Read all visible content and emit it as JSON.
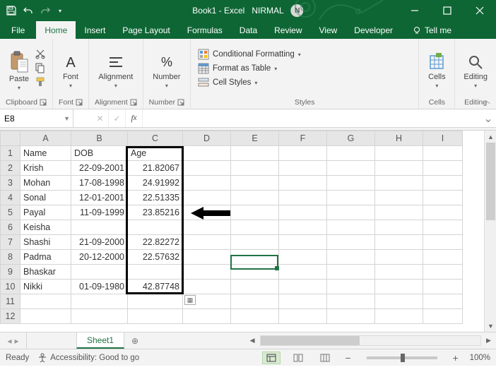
{
  "title": {
    "doc": "Book1",
    "app": "Excel",
    "user": "NIRMAL",
    "initial": "N"
  },
  "tabs": {
    "file": "File",
    "home": "Home",
    "insert": "Insert",
    "pageLayout": "Page Layout",
    "formulas": "Formulas",
    "data": "Data",
    "review": "Review",
    "view": "View",
    "developer": "Developer",
    "tellme": "Tell me"
  },
  "ribbon": {
    "clipboard": {
      "paste": "Paste",
      "label": "Clipboard"
    },
    "font": {
      "btn": "Font",
      "label": "Font"
    },
    "alignment": {
      "btn": "Alignment",
      "label": "Alignment"
    },
    "number": {
      "btn": "Number",
      "label": "Number"
    },
    "styles": {
      "cond": "Conditional Formatting",
      "table": "Format as Table",
      "cell": "Cell Styles",
      "label": "Styles"
    },
    "cells": {
      "btn": "Cells",
      "label": "Cells"
    },
    "editing": {
      "btn": "Editing",
      "label": "Editing"
    }
  },
  "namebox": "E8",
  "grid": {
    "cols": [
      "A",
      "B",
      "C",
      "D",
      "E",
      "F",
      "G",
      "H",
      "I"
    ],
    "headers": {
      "A": "Name",
      "B": "DOB",
      "C": "Age"
    },
    "rows": [
      {
        "n": "1"
      },
      {
        "n": "2",
        "A": "Krish",
        "B": "22-09-2001",
        "C": "21.82067"
      },
      {
        "n": "3",
        "A": "Mohan",
        "B": "17-08-1998",
        "C": "24.91992"
      },
      {
        "n": "4",
        "A": "Sonal",
        "B": "12-01-2001",
        "C": "22.51335"
      },
      {
        "n": "5",
        "A": "Payal",
        "B": "11-09-1999",
        "C": "23.85216"
      },
      {
        "n": "6",
        "A": "Keisha",
        "B": "",
        "C": ""
      },
      {
        "n": "7",
        "A": "Shashi",
        "B": "21-09-2000",
        "C": "22.82272"
      },
      {
        "n": "8",
        "A": "Padma",
        "B": "20-12-2000",
        "C": "22.57632"
      },
      {
        "n": "9",
        "A": "Bhaskar",
        "B": "",
        "C": ""
      },
      {
        "n": "10",
        "A": "Nikki",
        "B": "01-09-1980",
        "C": "42.87748"
      },
      {
        "n": "11"
      },
      {
        "n": "12"
      }
    ]
  },
  "sheettab": "Sheet1",
  "status": {
    "ready": "Ready",
    "access": "Accessibility: Good to go",
    "zoom": "100%"
  }
}
